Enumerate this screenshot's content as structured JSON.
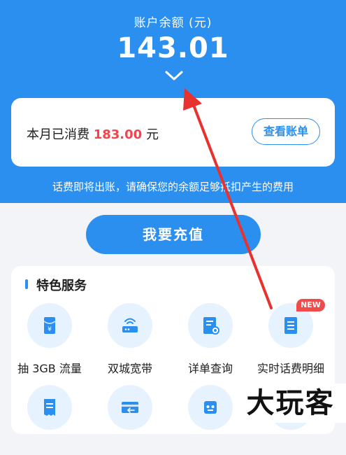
{
  "balance": {
    "label": "账户余额 (元)",
    "value": "143.01"
  },
  "bill_card": {
    "spent_prefix": "本月已消费",
    "spent_amount": "183.00",
    "spent_suffix": "元",
    "view_bill_button": "查看账单"
  },
  "notice": "话费即将出账，请确保您的余额足够抵扣产生的费用",
  "topup_button": "我要充值",
  "services": {
    "title": "特色服务",
    "items": [
      {
        "label": "抽 3GB 流量",
        "icon": "red-envelope-icon"
      },
      {
        "label": "双城宽带",
        "icon": "router-icon"
      },
      {
        "label": "详单查询",
        "icon": "document-search-icon"
      },
      {
        "label": "实时话费明细",
        "icon": "clipboard-list-icon",
        "badge": "NEW"
      },
      {
        "label": "",
        "icon": "receipt-icon"
      },
      {
        "label": "",
        "icon": "card-payment-icon"
      },
      {
        "label": "",
        "icon": "robot-icon"
      },
      {
        "label": "",
        "icon": "service-icon"
      }
    ]
  },
  "watermark": "大玩客",
  "colors": {
    "primary": "#2b8ff0",
    "amount": "#f0454b",
    "annotation_arrow": "#e8322f",
    "icon_bg": "#e6f2fd"
  }
}
